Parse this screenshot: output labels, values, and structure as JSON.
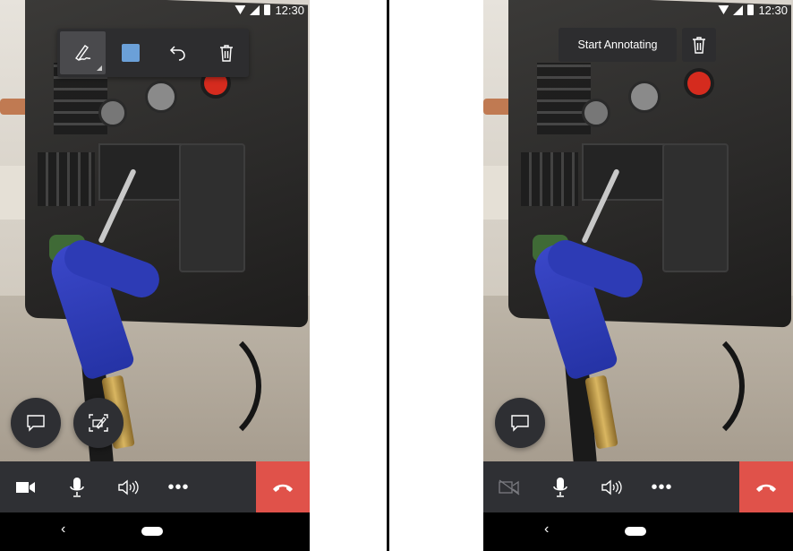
{
  "status_bar": {
    "time": "12:30"
  },
  "left_screen": {
    "toolbar": {
      "tools": [
        {
          "name": "pen-tool",
          "icon": "pen-icon",
          "active": true
        },
        {
          "name": "color-picker",
          "icon": "color-swatch-icon",
          "color": "#6BA0D8"
        },
        {
          "name": "undo",
          "icon": "undo-icon"
        },
        {
          "name": "delete",
          "icon": "trash-icon"
        }
      ]
    },
    "floating_buttons": [
      {
        "name": "chat",
        "icon": "chat-bubble-icon"
      },
      {
        "name": "annotate",
        "icon": "camera-annotate-icon"
      }
    ],
    "call_controls": [
      {
        "name": "video",
        "icon": "video-camera-icon",
        "state": "on"
      },
      {
        "name": "microphone",
        "icon": "microphone-icon"
      },
      {
        "name": "speaker",
        "icon": "speaker-icon"
      },
      {
        "name": "more",
        "icon": "ellipsis-icon",
        "label": "•••"
      },
      {
        "name": "end-call",
        "icon": "end-call-icon",
        "color": "#E0524A"
      }
    ]
  },
  "right_screen": {
    "start_annotating_label": "Start Annotating",
    "delete_icon": "trash-icon",
    "floating_buttons": [
      {
        "name": "chat",
        "icon": "chat-bubble-icon"
      }
    ],
    "call_controls": [
      {
        "name": "video",
        "icon": "video-off-icon",
        "state": "off"
      },
      {
        "name": "microphone",
        "icon": "microphone-icon"
      },
      {
        "name": "speaker",
        "icon": "speaker-icon"
      },
      {
        "name": "more",
        "icon": "ellipsis-icon",
        "label": "•••"
      },
      {
        "name": "end-call",
        "icon": "end-call-icon",
        "color": "#E0524A"
      }
    ]
  },
  "nav_bar": {
    "back_glyph": "‹"
  },
  "colors": {
    "toolbar_bg": "#2D2D2F",
    "callbar_bg": "#2F3034",
    "end_call": "#E0524A",
    "accent": "#6BA0D8"
  }
}
